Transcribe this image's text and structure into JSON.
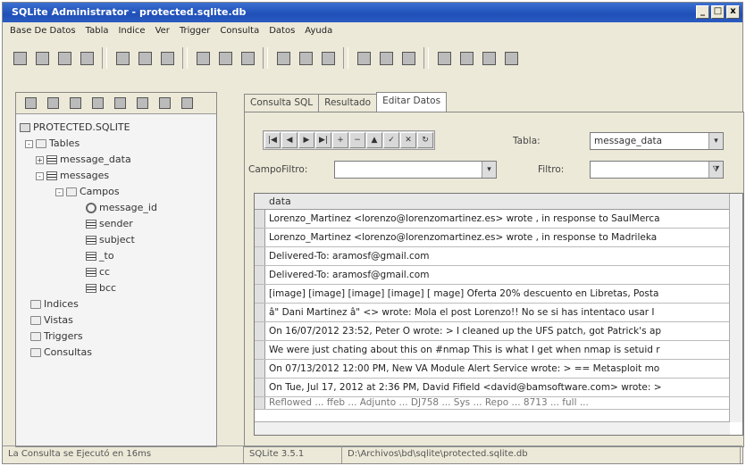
{
  "window": {
    "title": "SQLite Administrator - protected.sqlite.db"
  },
  "menu": [
    "Base De Datos",
    "Tabla",
    "Indice",
    "Ver",
    "Trigger",
    "Consulta",
    "Datos",
    "Ayuda"
  ],
  "tree": {
    "root": "PROTECTED.SQLITE",
    "tables": "Tables",
    "t1": "message_data",
    "t2": "messages",
    "campos": "Campos",
    "fields": [
      "message_id",
      "sender",
      "subject",
      "_to",
      "cc",
      "bcc"
    ],
    "indices": "Indices",
    "vistas": "Vistas",
    "triggers": "Triggers",
    "consultas": "Consultas"
  },
  "tabs": [
    "Consulta SQL",
    "Resultado",
    "Editar Datos"
  ],
  "editor": {
    "tabla_label": "Tabla:",
    "tabla_value": "message_data",
    "campo_label": "CampoFiltro:",
    "filtro_label": "Filtro:"
  },
  "grid": {
    "header": "data",
    "rows": [
      "Lorenzo_Martinez <lorenzo@lorenzomartinez.es> wrote , in response to SaulMerca",
      "Lorenzo_Martinez <lorenzo@lorenzomartinez.es> wrote , in response to Madrileka",
      "Delivered-To: aramosf@gmail.com",
      "Delivered-To: aramosf@gmail.com",
      "[image] [image] [image] [image] [ mage] Oferta 20% descuento en Libretas, Posta",
      "â\" Dani Martinez â\" <> wrote: Mola el post Lorenzo!! No se si has intentaco usar I",
      "On 16/07/2012 23:52, Peter O wrote: > I cleaned up the UFS patch, got Patrick's ap",
      "We were just chating about this on #nmap This is what I get when nmap is setuid r",
      "On 07/13/2012 12:00 PM, New VA Module Alert Service wrote: > == Metasploit mo",
      "On Tue, Jul 17, 2012 at 2:36 PM, David Fifield <david@bamsoftware.com> wrote: >",
      "Reflowed ... ffeb ... Adjunto ... DJ758 ... Sys ... Repo ... 8713 ... full ..."
    ]
  },
  "status": {
    "msg": "La Consulta se Ejecutó en 16ms",
    "ver": "SQLite 3.5.1",
    "path": "D:\\Archivos\\bd\\sqlite\\protected.sqlite.db"
  }
}
